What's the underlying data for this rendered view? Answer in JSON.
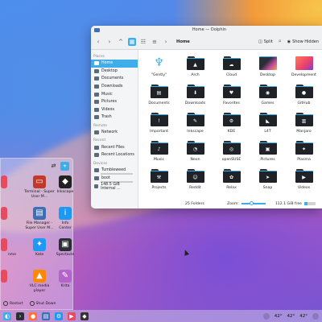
{
  "window": {
    "title": "Home — Dolphin",
    "breadcrumb": "Home",
    "split_label": "Split",
    "show_hidden_label": "Show Hidden"
  },
  "places": {
    "section_places": "Places",
    "items": [
      {
        "label": "Home"
      },
      {
        "label": "Desktop"
      },
      {
        "label": "Documents"
      },
      {
        "label": "Downloads"
      },
      {
        "label": "Music"
      },
      {
        "label": "Pictures"
      },
      {
        "label": "Videos"
      },
      {
        "label": "Trash"
      }
    ],
    "section_remote": "Remote",
    "remote_items": [
      {
        "label": "Network"
      }
    ],
    "section_recent": "Recent",
    "recent_items": [
      {
        "label": "Recent Files"
      },
      {
        "label": "Recent Locations"
      }
    ],
    "section_devices": "Devices",
    "device_items": [
      {
        "label": "Tumbleweed"
      },
      {
        "label": "boot"
      },
      {
        "label": "148.5 GiB Internal ..."
      }
    ]
  },
  "files": [
    {
      "name": "\"Gently\"",
      "icon": "gently"
    },
    {
      "name": "Arch",
      "icon": "arch"
    },
    {
      "name": "Cloud",
      "icon": "cloud"
    },
    {
      "name": "Desktop",
      "icon": "desktop"
    },
    {
      "name": "Development",
      "icon": "dev"
    },
    {
      "name": "Documents",
      "icon": "docs"
    },
    {
      "name": "Downloads",
      "icon": "download"
    },
    {
      "name": "Favorites",
      "icon": "heart"
    },
    {
      "name": "Games",
      "icon": "games"
    },
    {
      "name": "GitHub",
      "icon": "github"
    },
    {
      "name": "Important",
      "icon": "important"
    },
    {
      "name": "Inkscape",
      "icon": "inkscape"
    },
    {
      "name": "KDE",
      "icon": "kde"
    },
    {
      "name": "L4T",
      "icon": "l4t"
    },
    {
      "name": "Manjaro",
      "icon": "manjaro"
    },
    {
      "name": "Music",
      "icon": "music"
    },
    {
      "name": "Neon",
      "icon": "neon"
    },
    {
      "name": "openSUSE",
      "icon": "opensuse"
    },
    {
      "name": "Pictures",
      "icon": "pictures"
    },
    {
      "name": "Plasma",
      "icon": "plasma"
    },
    {
      "name": "Projects",
      "icon": "projects"
    },
    {
      "name": "Reddit",
      "icon": "reddit"
    },
    {
      "name": "Relax",
      "icon": "relax"
    },
    {
      "name": "Snap",
      "icon": "snap"
    },
    {
      "name": "Videos",
      "icon": "videos"
    }
  ],
  "status": {
    "count": "25 Folders",
    "zoom_label": "Zoom:",
    "free_space": "112.1 GiB free",
    "free_fraction": 0.25
  },
  "launcher": {
    "apps": [
      {
        "label": "",
        "icon": "partial"
      },
      {
        "label": "Terminal - Super User M...",
        "icon": "terminal"
      },
      {
        "label": "Inkscape",
        "icon": "inkscape"
      },
      {
        "label": "",
        "icon": "partial"
      },
      {
        "label": "File Manager - Super User M...",
        "icon": "file-manager"
      },
      {
        "label": "Info Center",
        "icon": "info"
      },
      {
        "label": "nme",
        "icon": "partial"
      },
      {
        "label": "Kate",
        "icon": "kate"
      },
      {
        "label": "Spectacle",
        "icon": "spectacle"
      },
      {
        "label": "",
        "icon": "partial"
      },
      {
        "label": "VLC media player",
        "icon": "vlc"
      },
      {
        "label": "Krita",
        "icon": "krita"
      }
    ],
    "restart_label": "Restart",
    "shutdown_label": "Shut Down"
  },
  "tray": {
    "temp1": "42°",
    "temp2": "42°",
    "temp3": "42°"
  }
}
